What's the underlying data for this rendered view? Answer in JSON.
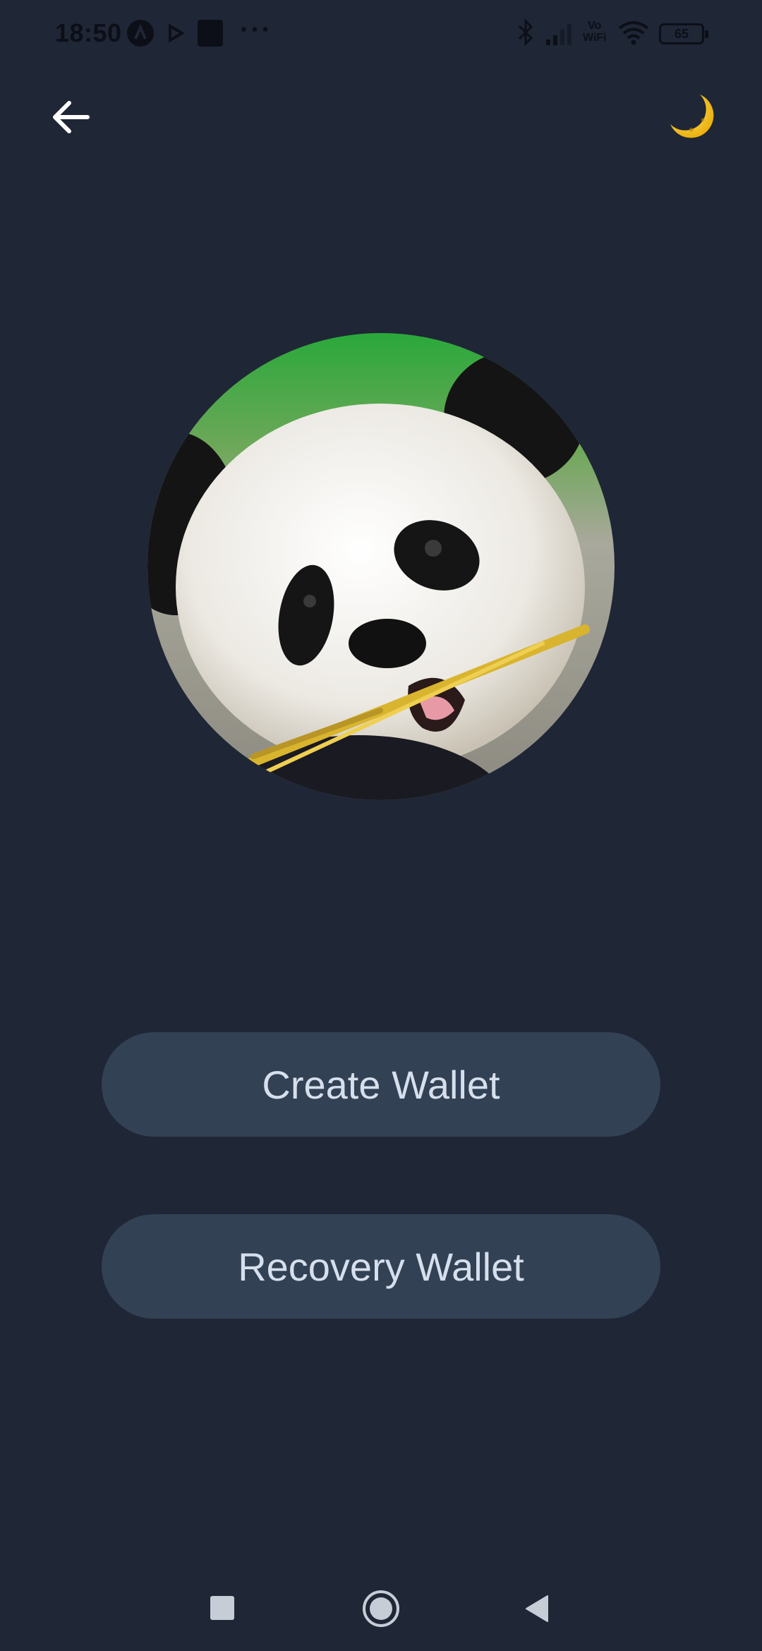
{
  "status_bar": {
    "time": "18:50",
    "icons": [
      "android-notification-icon",
      "play-icon",
      "app-notification-icon",
      "more-dots-icon",
      "bluetooth-icon",
      "signal-icon",
      "vowifi-icon",
      "wifi-icon",
      "battery-icon"
    ],
    "more": "···",
    "vowifi_top": "Vo",
    "vowifi_bottom": "WiFi",
    "battery": "65"
  },
  "header": {
    "back_icon": "arrow-left-icon",
    "theme_icon": "crescent-moon-icon",
    "theme_glyph": "🌙"
  },
  "main": {
    "avatar": "panda-avatar",
    "create_label": "Create Wallet",
    "recovery_label": "Recovery Wallet"
  },
  "nav_bar": {
    "icons": [
      "recents-icon",
      "home-icon",
      "back-triangle-icon"
    ]
  },
  "colors": {
    "background": "#1f2636",
    "button_bg": "#334155",
    "button_text": "#d6dfec",
    "moon": "#f5c518"
  }
}
